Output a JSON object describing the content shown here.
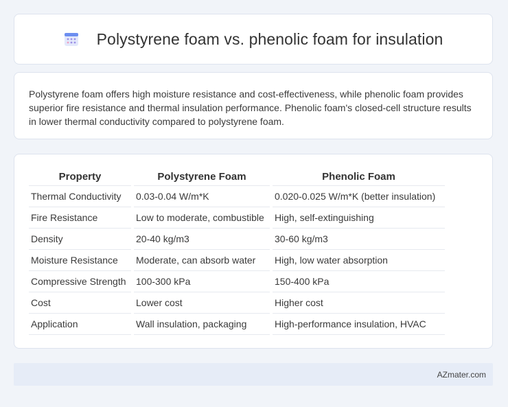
{
  "header": {
    "title": "Polystyrene foam vs. phenolic foam for insulation",
    "icon": "calendar-icon"
  },
  "summary": {
    "text": "Polystyrene foam offers high moisture resistance and cost-effectiveness, while phenolic foam provides superior fire resistance and thermal insulation performance. Phenolic foam's closed-cell structure results in lower thermal conductivity compared to polystyrene foam."
  },
  "table": {
    "headers": [
      "Property",
      "Polystyrene Foam",
      "Phenolic Foam"
    ],
    "rows": [
      [
        "Thermal Conductivity",
        "0.03-0.04 W/m*K",
        "0.020-0.025 W/m*K (better insulation)"
      ],
      [
        "Fire Resistance",
        "Low to moderate, combustible",
        "High, self-extinguishing"
      ],
      [
        "Density",
        "20-40 kg/m3",
        "30-60 kg/m3"
      ],
      [
        "Moisture Resistance",
        "Moderate, can absorb water",
        "High, low water absorption"
      ],
      [
        "Compressive Strength",
        "100-300 kPa",
        "150-400 kPa"
      ],
      [
        "Cost",
        "Lower cost",
        "Higher cost"
      ],
      [
        "Application",
        "Wall insulation, packaging",
        "High-performance insulation, HVAC"
      ]
    ]
  },
  "footer": {
    "site": "AZmater.com"
  }
}
